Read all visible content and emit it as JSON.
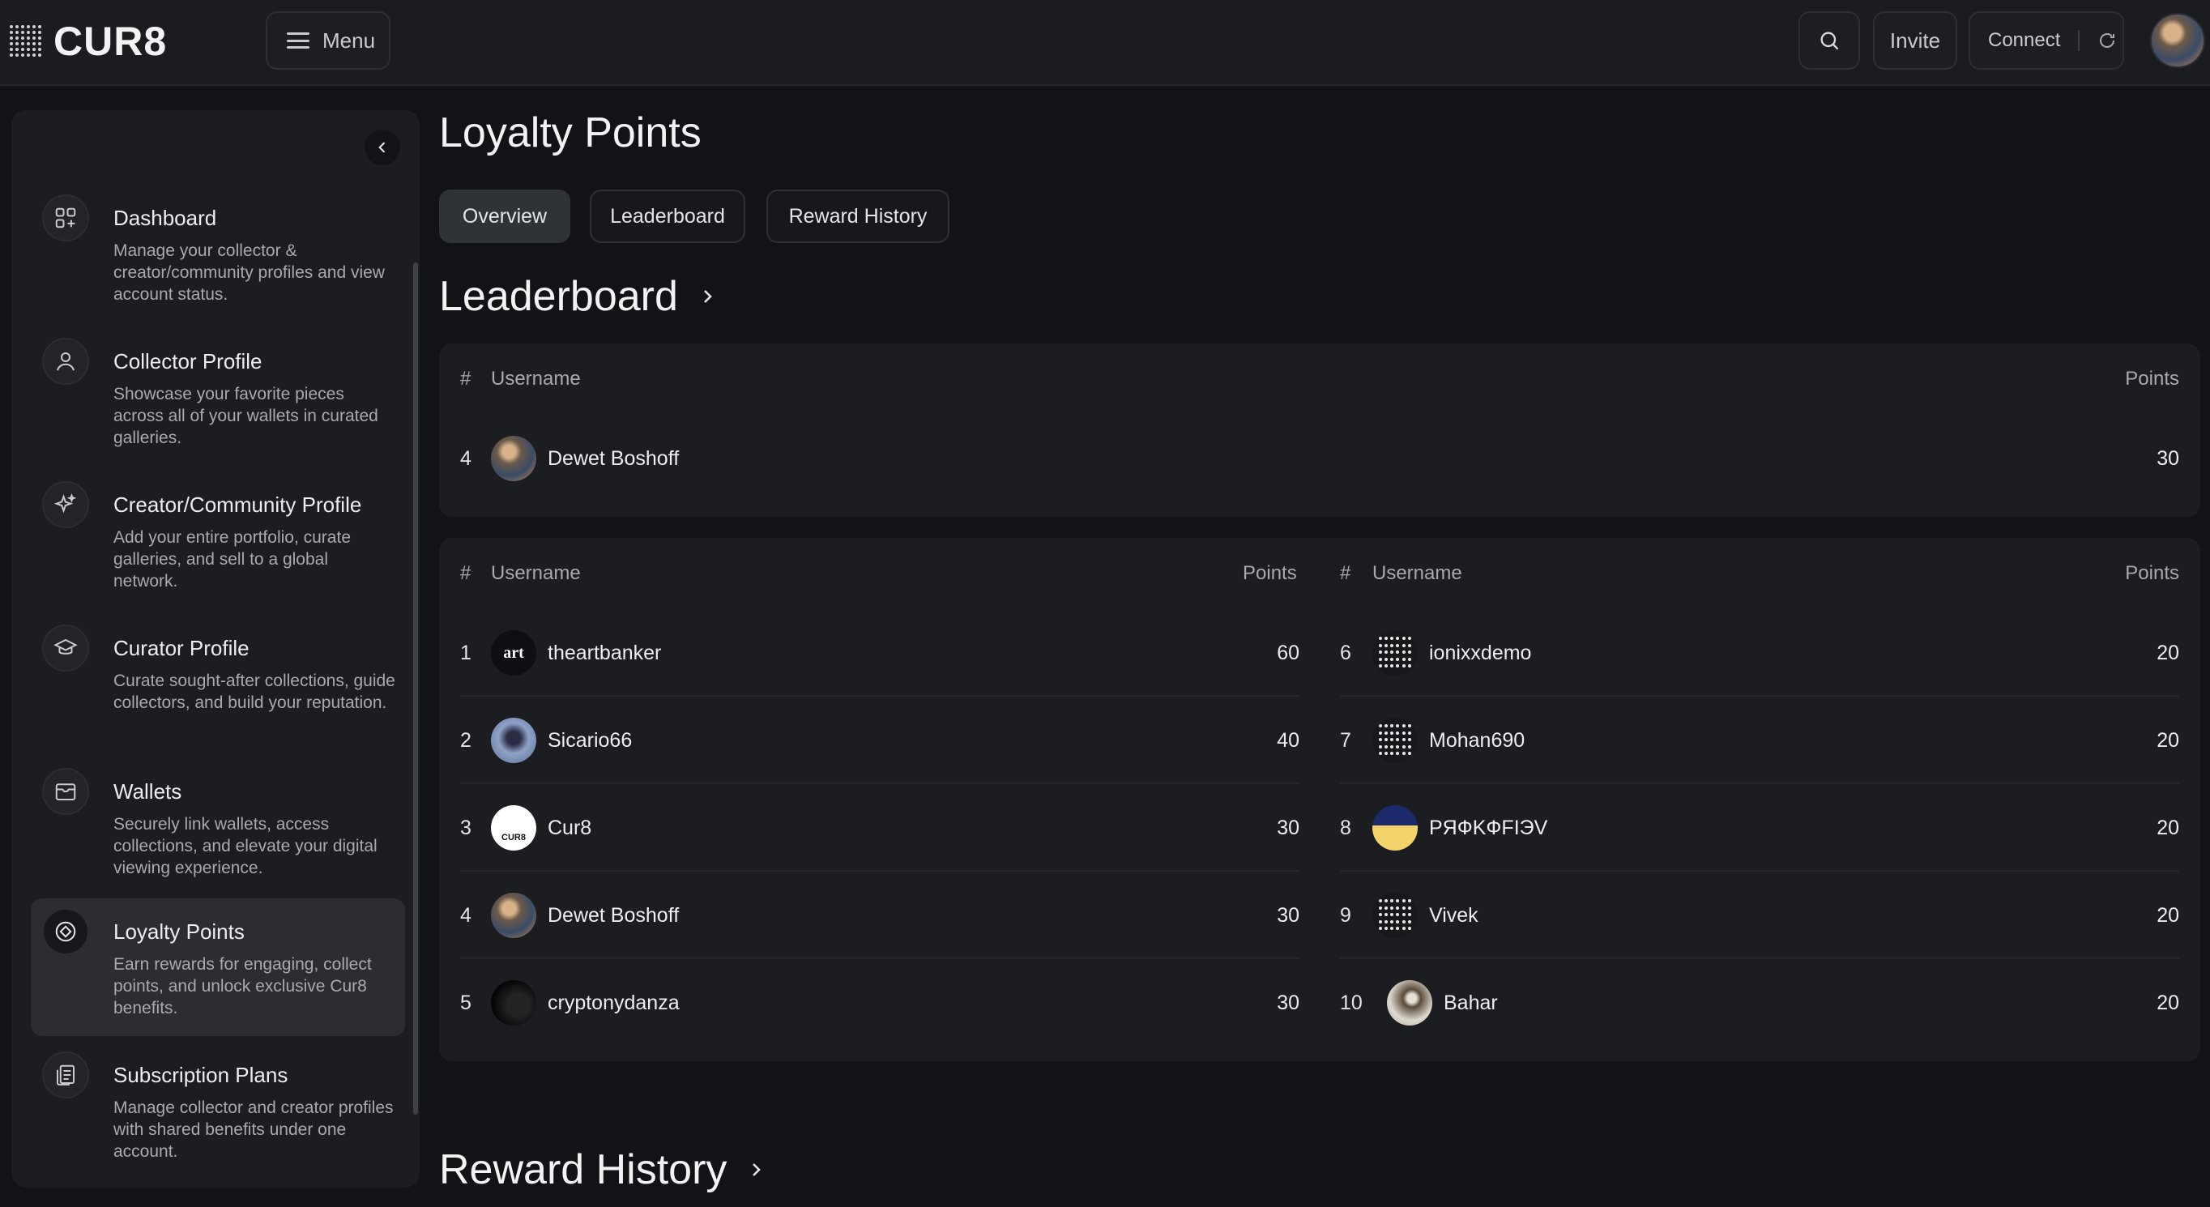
{
  "app": {
    "logo_text": "CUR8"
  },
  "topbar": {
    "menu_label": "Menu",
    "invite_label": "Invite",
    "connect_label": "Connect"
  },
  "sidebar": {
    "items": [
      {
        "title": "Dashboard",
        "desc": "Manage your collector & creator/community profiles and view account status.",
        "icon": "dashboard-icon"
      },
      {
        "title": "Collector Profile",
        "desc": "Showcase your favorite pieces across all of your wallets in curated galleries.",
        "icon": "user-icon"
      },
      {
        "title": "Creator/Community Profile",
        "desc": "Add your entire portfolio, curate galleries, and sell to a global network.",
        "icon": "sparkles-icon"
      },
      {
        "title": "Curator Profile",
        "desc": "Curate sought-after collections, guide collectors, and build your reputation.",
        "icon": "graduation-cap-icon"
      },
      {
        "title": "Wallets",
        "desc": "Securely link wallets, access collections, and elevate your digital viewing experience.",
        "icon": "wallet-icon"
      },
      {
        "title": "Loyalty Points",
        "desc": "Earn rewards for engaging, collect points, and unlock exclusive Cur8 benefits.",
        "icon": "diamond-icon",
        "active": true
      },
      {
        "title": "Subscription Plans",
        "desc": "Manage collector and creator profiles with shared benefits under one account.",
        "icon": "clipboard-icon"
      }
    ]
  },
  "main": {
    "page_title": "Loyalty Points",
    "tabs": [
      {
        "label": "Overview",
        "active": true
      },
      {
        "label": "Leaderboard",
        "active": false
      },
      {
        "label": "Reward History",
        "active": false
      }
    ],
    "leaderboard_title": "Leaderboard",
    "reward_history_title": "Reward History",
    "columns": {
      "rank": "#",
      "username": "Username",
      "points": "Points"
    },
    "my_rank": {
      "rank": "4",
      "username": "Dewet Boshoff",
      "points": "30"
    },
    "left_rows": [
      {
        "rank": "1",
        "username": "theartbanker",
        "points": "60"
      },
      {
        "rank": "2",
        "username": "Sicario66",
        "points": "40"
      },
      {
        "rank": "3",
        "username": "Cur8",
        "points": "30"
      },
      {
        "rank": "4",
        "username": "Dewet Boshoff",
        "points": "30"
      },
      {
        "rank": "5",
        "username": "cryptonydanza",
        "points": "30"
      }
    ],
    "right_rows": [
      {
        "rank": "6",
        "username": "ionixxdemo",
        "points": "20"
      },
      {
        "rank": "7",
        "username": "Mohan690",
        "points": "20"
      },
      {
        "rank": "8",
        "username": "PЯФKФFIЭV",
        "points": "20"
      },
      {
        "rank": "9",
        "username": "Vivek",
        "points": "20"
      },
      {
        "rank": "10",
        "username": "Bahar",
        "points": "20"
      }
    ],
    "avatar_text": {
      "art": "art",
      "cur8": "CUR8"
    }
  }
}
